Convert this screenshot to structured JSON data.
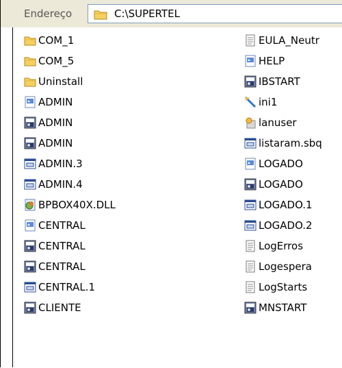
{
  "address_bar": {
    "label": "Endereço",
    "path": "C:\\SUPERTEL"
  },
  "files_col1": [
    {
      "name": "COM_1",
      "icon": "folder-icon"
    },
    {
      "name": "COM_5",
      "icon": "folder-icon"
    },
    {
      "name": "Uninstall",
      "icon": "folder-icon"
    },
    {
      "name": "ADMIN",
      "icon": "file-icon"
    },
    {
      "name": "ADMIN",
      "icon": "program-icon"
    },
    {
      "name": "ADMIN",
      "icon": "program-icon"
    },
    {
      "name": "ADMIN.3",
      "icon": "window-file-icon"
    },
    {
      "name": "ADMIN.4",
      "icon": "window-file-icon"
    },
    {
      "name": "BPBOX40X.DLL",
      "icon": "dll-icon"
    },
    {
      "name": "CENTRAL",
      "icon": "file-icon"
    },
    {
      "name": "CENTRAL",
      "icon": "program-icon"
    },
    {
      "name": "CENTRAL",
      "icon": "program-icon"
    },
    {
      "name": "CENTRAL.1",
      "icon": "window-file-icon"
    },
    {
      "name": "CLIENTE",
      "icon": "program-icon"
    }
  ],
  "files_col2": [
    {
      "name": "EULA_Neutr",
      "icon": "text-file-icon"
    },
    {
      "name": "HELP",
      "icon": "file-icon"
    },
    {
      "name": "IBSTART",
      "icon": "program-icon"
    },
    {
      "name": "ini1",
      "icon": "ini-icon"
    },
    {
      "name": "lanuser",
      "icon": "user-icon"
    },
    {
      "name": "listaram.sbq",
      "icon": "window-file-icon"
    },
    {
      "name": "LOGADO",
      "icon": "file-icon"
    },
    {
      "name": "LOGADO",
      "icon": "program-icon"
    },
    {
      "name": "LOGADO.1",
      "icon": "window-file-icon"
    },
    {
      "name": "LOGADO.2",
      "icon": "window-file-icon"
    },
    {
      "name": "LogErros",
      "icon": "text-file-icon"
    },
    {
      "name": "Logespera",
      "icon": "text-file-icon"
    },
    {
      "name": "LogStarts",
      "icon": "text-file-icon"
    },
    {
      "name": "MNSTART",
      "icon": "program-icon"
    }
  ]
}
